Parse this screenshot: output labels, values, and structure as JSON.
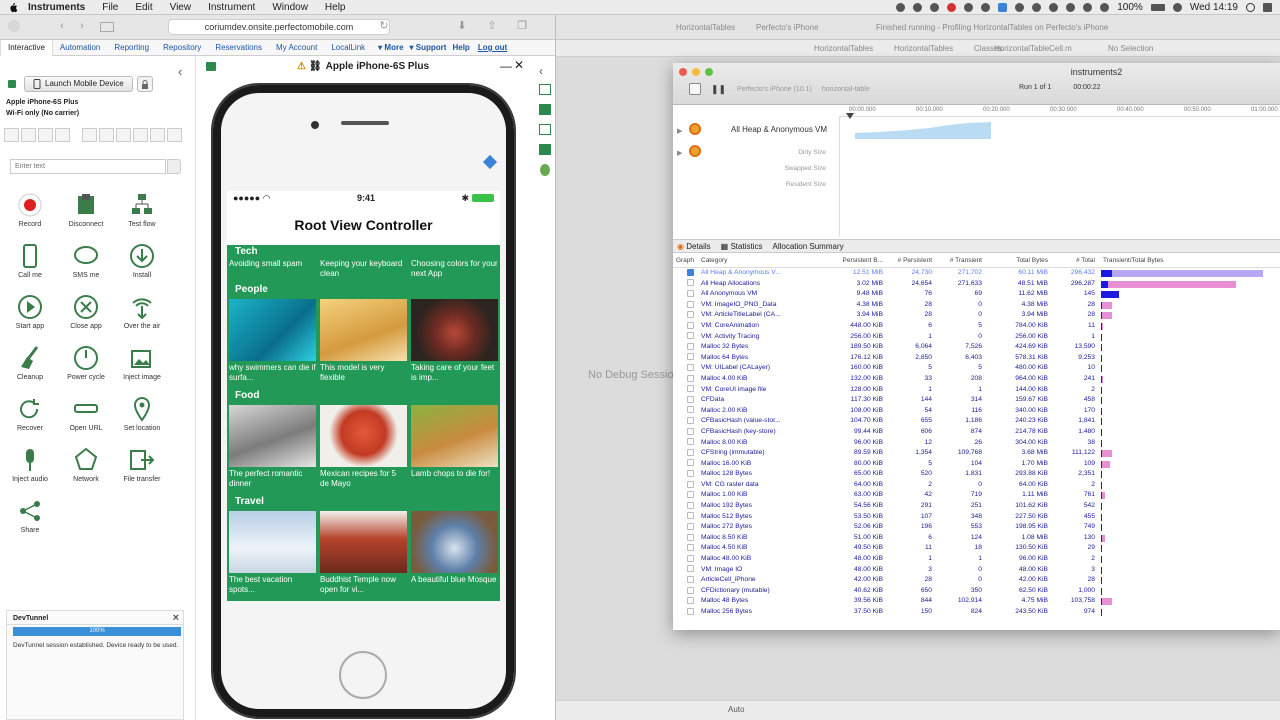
{
  "menubar": {
    "app": "Instruments",
    "items": [
      "File",
      "Edit",
      "View",
      "Instrument",
      "Window",
      "Help"
    ],
    "battery": "100%",
    "clock": "Wed 14:19"
  },
  "browser": {
    "url": "coriumdev.onsite.perfectomobile.com",
    "tabs": [
      "Interactive",
      "Automation",
      "Reporting",
      "Repository",
      "Reservations",
      "My Account",
      "LocalLink"
    ],
    "more": "More",
    "support": "Support",
    "help": "Help",
    "logout": "Log out"
  },
  "left_panel": {
    "launch_label": "Launch Mobile Device",
    "device_name": "Apple iPhone-6S Plus",
    "connection": "Wi-Fi only (No carrier)",
    "text_placeholder": "Enter text",
    "actions": [
      {
        "label": "Record",
        "icon": "record-icon"
      },
      {
        "label": "Disconnect",
        "icon": "disconnect-icon"
      },
      {
        "label": "Test flow",
        "icon": "test-flow-icon"
      },
      {
        "label": "Call me",
        "icon": "call-icon"
      },
      {
        "label": "SMS me",
        "icon": "sms-icon"
      },
      {
        "label": "Install",
        "icon": "install-icon"
      },
      {
        "label": "Start app",
        "icon": "start-app-icon"
      },
      {
        "label": "Close app",
        "icon": "close-app-icon"
      },
      {
        "label": "Over the air",
        "icon": "over-the-air-icon"
      },
      {
        "label": "Cleanup",
        "icon": "cleanup-icon"
      },
      {
        "label": "Power cycle",
        "icon": "power-icon"
      },
      {
        "label": "Inject image",
        "icon": "inject-image-icon"
      },
      {
        "label": "Recover",
        "icon": "recover-icon"
      },
      {
        "label": "Open URL",
        "icon": "open-url-icon"
      },
      {
        "label": "Set location",
        "icon": "location-icon"
      },
      {
        "label": "Inject audio",
        "icon": "inject-audio-icon"
      },
      {
        "label": "Network",
        "icon": "network-icon"
      },
      {
        "label": "File transfer",
        "icon": "file-transfer-icon"
      },
      {
        "label": "Share",
        "icon": "share-icon"
      }
    ],
    "devtunnel": {
      "title": "DevTunnel",
      "progress": "100%",
      "progress_value": 1.0,
      "message": "DevTunnel session established. Device ready to be used."
    }
  },
  "device": {
    "title": "Apple iPhone-6S Plus",
    "status_time": "9:41",
    "nav_title": "Root View Controller",
    "partial_captions": [
      "Avoiding small spam",
      "Keeping your keyboard clean",
      "Choosing colors for your next App"
    ],
    "sections": [
      {
        "name": "Tech"
      },
      {
        "name": "People",
        "captions": [
          "why swimmers can die if surfa...",
          "This model is very flexible",
          "Taking care of your feet is imp..."
        ]
      },
      {
        "name": "Food",
        "captions": [
          "The perfect romantic dinner",
          "Mexican recipes for 5 de Mayo",
          "Lamb chops to die for!"
        ]
      },
      {
        "name": "Travel",
        "captions": [
          "The best vacation spots...",
          "Buddhist Temple now open for vi...",
          "A beautiful blue Mosque"
        ]
      }
    ]
  },
  "xcode": {
    "tab1": "HorizontalTables",
    "tab2": "Perfecto's iPhone",
    "status": "Finished running - Profiling HorizontalTables on Perfecto's iPhone",
    "crumbs": [
      "HorizontalTables",
      "HorizontalTables",
      "Classes",
      "HorizontalTableCell.m",
      "No Selection"
    ],
    "no_debug": "No Debug Session",
    "auto_label": "Auto"
  },
  "instruments": {
    "title": "instruments2",
    "target_device": "Perfecto's iPhone (10.1)",
    "target_app": "horizontal-table",
    "run": "Run 1 of 1",
    "elapsed": "00:00:22",
    "ruler": [
      "00:00.000",
      "00:10.000",
      "00:20.000",
      "00:30.000",
      "00:40.000",
      "00:50.000",
      "01:00.000"
    ],
    "track1": "All Heap & Anonymous VM",
    "track2_labels": [
      "Dirty Size",
      "Swapped Size",
      "Resident Size"
    ],
    "detail_tabs": [
      "Details",
      "Statistics",
      "Allocation Summary"
    ],
    "columns": [
      "Graph",
      "Category",
      "Persistent B...",
      "# Persistent",
      "# Transient",
      "Total Bytes",
      "# Total",
      "Transient/Total Bytes"
    ],
    "rows": [
      {
        "cat": "All Heap & Anonymous V...",
        "pb": "12.51 MiB",
        "p": "24,730",
        "t": "271,702",
        "tb": "60.11 MiB",
        "tot": "296,432",
        "pf": 0.06,
        "tf": 0.9,
        "sel": true
      },
      {
        "cat": "All Heap Allocations",
        "pb": "3.02 MiB",
        "p": "24,654",
        "t": "271,633",
        "tb": "48.51 MiB",
        "tot": "296,287",
        "pf": 0.04,
        "tf": 0.75
      },
      {
        "cat": "All Anonymous VM",
        "pb": "9.48 MiB",
        "p": "76",
        "t": "69",
        "tb": "11.62 MiB",
        "tot": "145",
        "pf": 0.1,
        "tf": 0.08
      },
      {
        "cat": "VM: ImageIO_PNG_Data",
        "pb": "4.38 MiB",
        "p": "28",
        "t": "0",
        "tb": "4.38 MiB",
        "tot": "28",
        "pf": 0.0,
        "tf": 0.06
      },
      {
        "cat": "VM: ArticleTitleLabel (CA...",
        "pb": "3.94 MiB",
        "p": "28",
        "t": "0",
        "tb": "3.94 MiB",
        "tot": "28",
        "pf": 0.0,
        "tf": 0.06
      },
      {
        "cat": "VM: CoreAnimation",
        "pb": "448.00 KiB",
        "p": "6",
        "t": "5",
        "tb": "784.00 KiB",
        "tot": "11",
        "pf": 0.0,
        "tf": 0.01
      },
      {
        "cat": "VM: Activity Tracing",
        "pb": "256.00 KiB",
        "p": "1",
        "t": "0",
        "tb": "256.00 KiB",
        "tot": "1",
        "pf": 0.0,
        "tf": 0.004
      },
      {
        "cat": "Malloc 32 Bytes",
        "pb": "189.50 KiB",
        "p": "6,064",
        "t": "7,526",
        "tb": "424.69 KiB",
        "tot": "13,590",
        "pf": 0.0,
        "tf": 0.005
      },
      {
        "cat": "Malloc 64 Bytes",
        "pb": "176.12 KiB",
        "p": "2,850",
        "t": "6,403",
        "tb": "578.31 KiB",
        "tot": "9,253",
        "pf": 0.0,
        "tf": 0.006
      },
      {
        "cat": "VM: UILabel (CALayer)",
        "pb": "160.00 KiB",
        "p": "5",
        "t": "5",
        "tb": "480.00 KiB",
        "tot": "10",
        "pf": 0.0,
        "tf": 0.005
      },
      {
        "cat": "Malloc 4.00 KiB",
        "pb": "132.00 KiB",
        "p": "33",
        "t": "208",
        "tb": "964.00 KiB",
        "tot": "241",
        "pf": 0.0,
        "tf": 0.01
      },
      {
        "cat": "VM: CoreUI image file",
        "pb": "128.00 KiB",
        "p": "1",
        "t": "1",
        "tb": "144.00 KiB",
        "tot": "2",
        "pf": 0.0,
        "tf": 0.003
      },
      {
        "cat": "CFData",
        "pb": "117.30 KiB",
        "p": "144",
        "t": "314",
        "tb": "159.67 KiB",
        "tot": "458",
        "pf": 0.0,
        "tf": 0.003
      },
      {
        "cat": "Malloc 2.00 KiB",
        "pb": "108.00 KiB",
        "p": "54",
        "t": "116",
        "tb": "340.00 KiB",
        "tot": "170",
        "pf": 0.0,
        "tf": 0.004
      },
      {
        "cat": "CFBasicHash (value-stor...",
        "pb": "104.70 KiB",
        "p": "655",
        "t": "1,186",
        "tb": "240.23 KiB",
        "tot": "1,841",
        "pf": 0.0,
        "tf": 0.004
      },
      {
        "cat": "CFBasicHash (key-store)",
        "pb": "99.44 KiB",
        "p": "606",
        "t": "874",
        "tb": "214.78 KiB",
        "tot": "1,480",
        "pf": 0.0,
        "tf": 0.004
      },
      {
        "cat": "Malloc 8.00 KiB",
        "pb": "96.00 KiB",
        "p": "12",
        "t": "26",
        "tb": "304.00 KiB",
        "tot": "38",
        "pf": 0.0,
        "tf": 0.004
      },
      {
        "cat": "CFString (immutable)",
        "pb": "89.59 KiB",
        "p": "1,354",
        "t": "109,768",
        "tb": "3.68 MiB",
        "tot": "111,122",
        "pf": 0.0,
        "tf": 0.06
      },
      {
        "cat": "Malloc 16.00 KiB",
        "pb": "80.00 KiB",
        "p": "5",
        "t": "104",
        "tb": "1.70 MiB",
        "tot": "109",
        "pf": 0.0,
        "tf": 0.05
      },
      {
        "cat": "Malloc 128 Bytes",
        "pb": "65.00 KiB",
        "p": "520",
        "t": "1,831",
        "tb": "293.88 KiB",
        "tot": "2,351",
        "pf": 0.0,
        "tf": 0.004
      },
      {
        "cat": "VM: CG raster data",
        "pb": "64.00 KiB",
        "p": "2",
        "t": "0",
        "tb": "64.00 KiB",
        "tot": "2",
        "pf": 0.0,
        "tf": 0.002
      },
      {
        "cat": "Malloc 1.00 KiB",
        "pb": "63.00 KiB",
        "p": "42",
        "t": "719",
        "tb": "1.11 MiB",
        "tot": "761",
        "pf": 0.0,
        "tf": 0.02
      },
      {
        "cat": "Malloc 192 Bytes",
        "pb": "54.56 KiB",
        "p": "291",
        "t": "251",
        "tb": "101.62 KiB",
        "tot": "542",
        "pf": 0.0,
        "tf": 0.002
      },
      {
        "cat": "Malloc 512 Bytes",
        "pb": "53.50 KiB",
        "p": "107",
        "t": "348",
        "tb": "227.50 KiB",
        "tot": "455",
        "pf": 0.0,
        "tf": 0.004
      },
      {
        "cat": "Malloc 272 Bytes",
        "pb": "52.06 KiB",
        "p": "196",
        "t": "553",
        "tb": "198.95 KiB",
        "tot": "749",
        "pf": 0.0,
        "tf": 0.003
      },
      {
        "cat": "Malloc 8.50 KiB",
        "pb": "51.00 KiB",
        "p": "6",
        "t": "124",
        "tb": "1.08 MiB",
        "tot": "130",
        "pf": 0.0,
        "tf": 0.02
      },
      {
        "cat": "Malloc 4.50 KiB",
        "pb": "49.50 KiB",
        "p": "11",
        "t": "18",
        "tb": "130.50 KiB",
        "tot": "29",
        "pf": 0.0,
        "tf": 0.002
      },
      {
        "cat": "Malloc 48.00 KiB",
        "pb": "48.00 KiB",
        "p": "1",
        "t": "1",
        "tb": "96.00 KiB",
        "tot": "2",
        "pf": 0.0,
        "tf": 0.002
      },
      {
        "cat": "VM: Image IO",
        "pb": "48.00 KiB",
        "p": "3",
        "t": "0",
        "tb": "48.00 KiB",
        "tot": "3",
        "pf": 0.0,
        "tf": 0.002
      },
      {
        "cat": "ArticleCell_iPhone",
        "pb": "42.00 KiB",
        "p": "28",
        "t": "0",
        "tb": "42.00 KiB",
        "tot": "28",
        "pf": 0.0,
        "tf": 0.002
      },
      {
        "cat": "CFDictionary (mutable)",
        "pb": "40.62 KiB",
        "p": "650",
        "t": "350",
        "tb": "62.50 KiB",
        "tot": "1,000",
        "pf": 0.0,
        "tf": 0.002
      },
      {
        "cat": "Malloc 48 Bytes",
        "pb": "39.56 KiB",
        "p": "844",
        "t": "102,914",
        "tb": "4.75 MiB",
        "tot": "103,758",
        "pf": 0.0,
        "tf": 0.06
      },
      {
        "cat": "Malloc 256 Bytes",
        "pb": "37.50 KiB",
        "p": "150",
        "t": "824",
        "tb": "243.50 KiB",
        "tot": "974",
        "pf": 0.0,
        "tf": 0.004
      }
    ]
  },
  "colors": {
    "app_green": "#229956",
    "persistent_bar": "#1a1ae0",
    "transient_bar_selected": "#b7a7f5",
    "transient_bar": "#e88fd4",
    "heap_graph": "#b9dcf4",
    "devtunnel_bar": "#3b8fd6"
  }
}
